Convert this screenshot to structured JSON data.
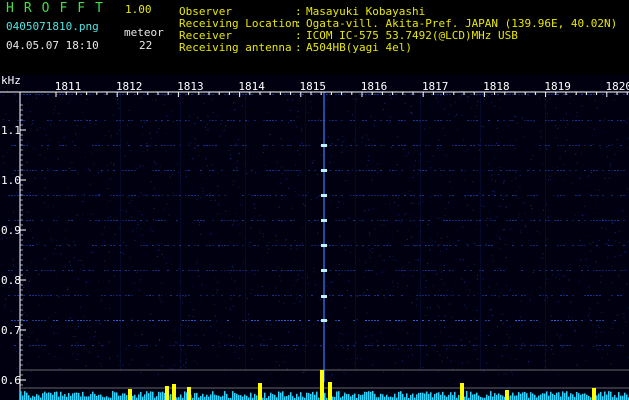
{
  "app": {
    "title": "HROFFT",
    "version": "1.00"
  },
  "file": {
    "name": "0405071810.png",
    "datetime": "04.05.07 18:10",
    "meteor_label": "meteor",
    "meteor_count": "22"
  },
  "info": {
    "rows": [
      {
        "label": "Observer",
        "sep": ":",
        "value": "Masayuki Kobayashi"
      },
      {
        "label": "Receiving Location",
        "sep": ":",
        "value": "Ogata-vill. Akita-Pref. JAPAN (139.96E, 40.02N)"
      },
      {
        "label": "Receiver",
        "sep": ":",
        "value": "ICOM IC-575 53.7492(@LCD)MHz USB"
      },
      {
        "label": "Receiving antenna",
        "sep": ":",
        "value": "A504HB(yagi 4el)"
      }
    ]
  },
  "spectrogram": {
    "unit_label": "kHz",
    "time_ticks": [
      "1811",
      "1812",
      "1813",
      "1814",
      "1815",
      "1816",
      "1817",
      "1818",
      "1819",
      "1820"
    ],
    "freq_ticks": [
      "1.1",
      "1.0",
      "0.9",
      "0.8",
      "0.7",
      "0.6"
    ],
    "colors": {
      "background": "#000010",
      "noise": "#1a3aa8",
      "grid_text": "#ffffff",
      "level_bar": "#2ad6ff",
      "meteor_spike": "#ffff00"
    }
  }
}
